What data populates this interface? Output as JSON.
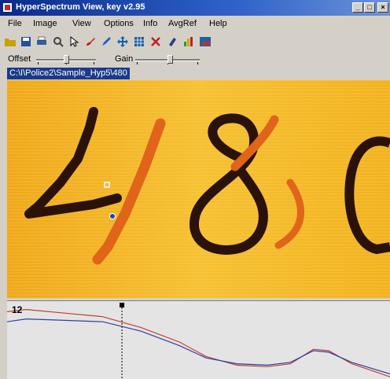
{
  "window": {
    "title": "HyperSpectrum View, key v2.95",
    "min_label": "_",
    "max_label": "□",
    "close_label": "×"
  },
  "menu": {
    "items": [
      "File",
      "Image",
      "View",
      "Options",
      "Info",
      "AvgRef",
      "Help"
    ]
  },
  "toolbar": {
    "tools": [
      {
        "name": "open-folder-icon",
        "color": "#c8a000"
      },
      {
        "name": "save-disk-icon",
        "color": "#2050a0"
      },
      {
        "name": "print-icon",
        "color": "#3060a0"
      },
      {
        "name": "zoom-icon",
        "color": "#404040"
      },
      {
        "name": "pointer-icon",
        "color": "#000000"
      },
      {
        "name": "brush-icon",
        "color": "#c02020"
      },
      {
        "name": "pen-icon",
        "color": "#2060c0"
      },
      {
        "name": "move-icon",
        "color": "#1060b0"
      },
      {
        "name": "grid-icon",
        "color": "#2060a0"
      },
      {
        "name": "close-x-icon",
        "color": "#c02020"
      },
      {
        "name": "marker-icon",
        "color": "#204080"
      },
      {
        "name": "bars-icon",
        "color": "#20a040"
      },
      {
        "name": "image-icon",
        "color": "#c03030"
      }
    ]
  },
  "controls": {
    "offset_label": "Offset",
    "gain_label": "Gain",
    "offset_level": 0.5,
    "gain_level": 0.55
  },
  "file_path": "C:\\I\\Police2\\Sample_Hyp5\\480",
  "image": {
    "digits_dark": "48",
    "colors": {
      "bg": "#f2b21c",
      "ink": "#2a1208",
      "orange_ink": "#e0641a"
    }
  },
  "spectrum": {
    "y_tick": "12",
    "colors": {
      "red": "#c04030",
      "blue": "#3040a0",
      "cursor": "#000000"
    },
    "cursor_x": 0.3,
    "red_curve": [
      [
        0,
        0.92
      ],
      [
        0.05,
        0.95
      ],
      [
        0.15,
        0.9
      ],
      [
        0.25,
        0.85
      ],
      [
        0.35,
        0.7
      ],
      [
        0.45,
        0.5
      ],
      [
        0.52,
        0.3
      ],
      [
        0.6,
        0.18
      ],
      [
        0.68,
        0.16
      ],
      [
        0.74,
        0.2
      ],
      [
        0.8,
        0.4
      ],
      [
        0.84,
        0.38
      ],
      [
        0.9,
        0.2
      ],
      [
        1.0,
        0.02
      ]
    ],
    "blue_curve": [
      [
        0,
        0.78
      ],
      [
        0.05,
        0.82
      ],
      [
        0.15,
        0.8
      ],
      [
        0.25,
        0.78
      ],
      [
        0.35,
        0.65
      ],
      [
        0.45,
        0.45
      ],
      [
        0.52,
        0.28
      ],
      [
        0.6,
        0.2
      ],
      [
        0.68,
        0.18
      ],
      [
        0.74,
        0.22
      ],
      [
        0.8,
        0.38
      ],
      [
        0.84,
        0.36
      ],
      [
        0.9,
        0.22
      ],
      [
        1.0,
        0.06
      ]
    ]
  }
}
